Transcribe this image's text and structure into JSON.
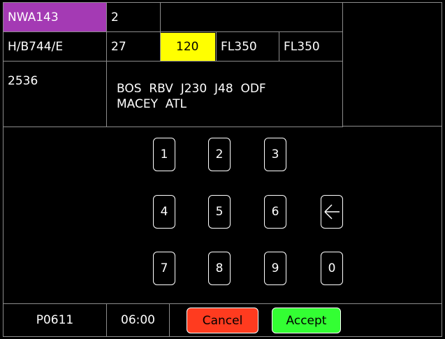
{
  "flight_strip": {
    "callsign": "NWA143",
    "row1_col2": "2",
    "aircraft_type": "H/B744/E",
    "row2_col2": "27",
    "highlighted_value": "120",
    "altitude_1": "FL350",
    "altitude_2": "FL350",
    "beacon_code": "2536",
    "route_line1": "BOS  RBV  J230  J48  ODF",
    "route_line2": "MACEY  ATL"
  },
  "keypad": {
    "keys": [
      "1",
      "2",
      "3",
      "4",
      "5",
      "6",
      "7",
      "8",
      "9",
      "0"
    ],
    "backspace_icon": "left-arrow-icon"
  },
  "footer": {
    "position_code": "P0611",
    "time": "06:00",
    "cancel_label": "Cancel",
    "accept_label": "Accept"
  },
  "colors": {
    "callsign_bg": "#a43ab4",
    "highlight_bg": "#ffff00",
    "cancel_bg": "#ff3b1f",
    "accept_bg": "#33ff33"
  }
}
